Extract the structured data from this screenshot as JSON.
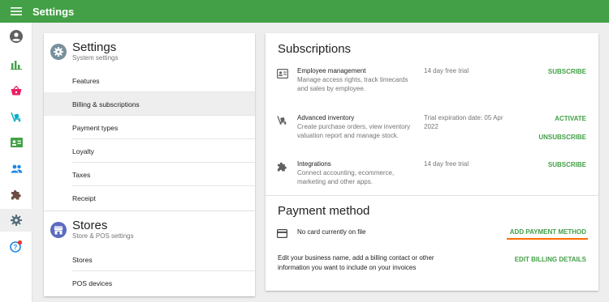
{
  "topbar": {
    "title": "Settings",
    "menu_icon": "hamburger-icon",
    "color": "#43a047"
  },
  "rail": {
    "items": [
      {
        "icon": "account-circle-icon",
        "color": "#616161"
      },
      {
        "icon": "bar-chart-icon",
        "color": "#43a047"
      },
      {
        "icon": "basket-icon",
        "color": "#e91e63"
      },
      {
        "icon": "trolley-icon",
        "color": "#00acc1"
      },
      {
        "icon": "id-card-icon",
        "color": "#43a047"
      },
      {
        "icon": "people-icon",
        "color": "#1e88e5"
      },
      {
        "icon": "puzzle-icon",
        "color": "#6d4c41"
      },
      {
        "icon": "gear-icon",
        "color": "#546e7a",
        "active": true
      },
      {
        "icon": "help-icon",
        "color": "#1e88e5",
        "badge_color": "#e53935"
      }
    ]
  },
  "settings_group": {
    "title": "Settings",
    "subtitle": "System settings",
    "items": [
      {
        "label": "Features"
      },
      {
        "label": "Billing & subscriptions",
        "selected": true
      },
      {
        "label": "Payment types"
      },
      {
        "label": "Loyalty"
      },
      {
        "label": "Taxes"
      },
      {
        "label": "Receipt"
      }
    ]
  },
  "stores_group": {
    "title": "Stores",
    "subtitle": "Store & POS settings",
    "items": [
      {
        "label": "Stores"
      },
      {
        "label": "POS devices"
      }
    ]
  },
  "subscriptions": {
    "title": "Subscriptions",
    "items": [
      {
        "icon": "id-badge-icon",
        "name": "Employee management",
        "description": "Manage access rights, track timecards and sales by employee.",
        "status": "14 day free trial",
        "actions": [
          "SUBSCRIBE"
        ]
      },
      {
        "icon": "trolley-icon",
        "name": "Advanced inventory",
        "description": "Create purchase orders, view inventory valuation report and manage stock.",
        "status": "Trial expiration date: 05 Apr 2022",
        "actions": [
          "ACTIVATE",
          "UNSUBSCRIBE"
        ]
      },
      {
        "icon": "puzzle-icon",
        "name": "Integrations",
        "description": "Connect accounting, ecommerce, marketing and other apps.",
        "status": "14 day free trial",
        "actions": [
          "SUBSCRIBE"
        ]
      }
    ]
  },
  "payment": {
    "title": "Payment method",
    "card_icon": "credit-card-icon",
    "card_text": "No card currently on file",
    "add_label": "ADD PAYMENT METHOD",
    "billing_text": "Edit your business name, add a billing contact or other information you want to include on your invoices",
    "edit_label": "EDIT BILLING DETAILS",
    "highlight_color": "#ff6d00"
  }
}
